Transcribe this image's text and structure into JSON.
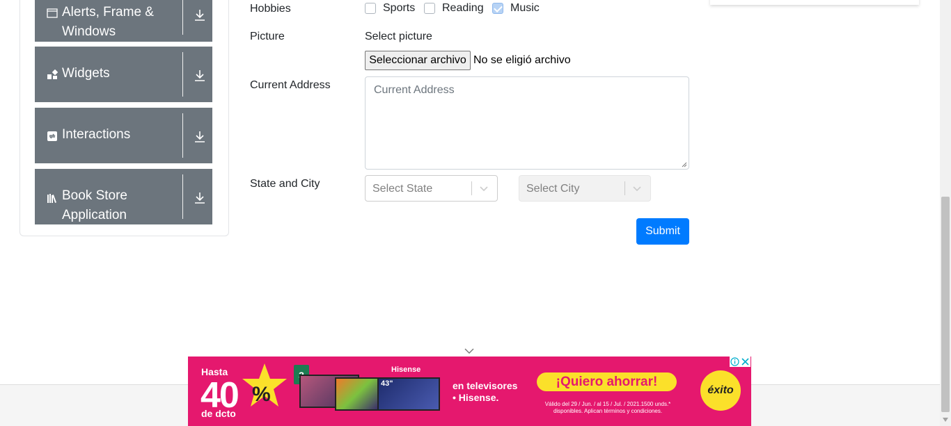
{
  "sidebar": {
    "groups": [
      {
        "label": "Alerts, Frame & Windows",
        "icon": "window-icon"
      },
      {
        "label": "Widgets",
        "icon": "widgets-icon"
      },
      {
        "label": "Interactions",
        "icon": "interactions-icon"
      },
      {
        "label": "Book Store Application",
        "icon": "books-icon"
      }
    ]
  },
  "form": {
    "hobbies": {
      "label": "Hobbies",
      "options": [
        {
          "label": "Sports",
          "checked": false
        },
        {
          "label": "Reading",
          "checked": false
        },
        {
          "label": "Music",
          "checked": true
        }
      ]
    },
    "picture": {
      "label": "Picture",
      "select_label": "Select picture",
      "file_button": "Seleccionar archivo",
      "file_status": "No se eligió archivo"
    },
    "address": {
      "label": "Current Address",
      "placeholder": "Current Address"
    },
    "state_city": {
      "label": "State and City",
      "state_placeholder": "Select State",
      "city_placeholder": "Select City"
    },
    "submit_label": "Submit"
  },
  "banner": {
    "hasta": "Hasta",
    "discount": "40",
    "percent": "%",
    "dcto": "de dcto",
    "badge": "3",
    "brand": "Hisense",
    "tv_size": "43\"",
    "tagline_1": "en televisores",
    "tagline_2": "• Hisense.",
    "cta": "¡Quiero ahorrar!",
    "fine_print": "Válido del 29 / Jun. / al 15 / Jul. / 2021.1500 unds.* disponibles. Aplican términos y condiciones.",
    "retailer": "éxito"
  },
  "colors": {
    "sidebar_bg": "#6c757d",
    "submit_bg": "#007bff",
    "banner_bg": "#e5186e",
    "banner_cta": "#fbe02a"
  }
}
